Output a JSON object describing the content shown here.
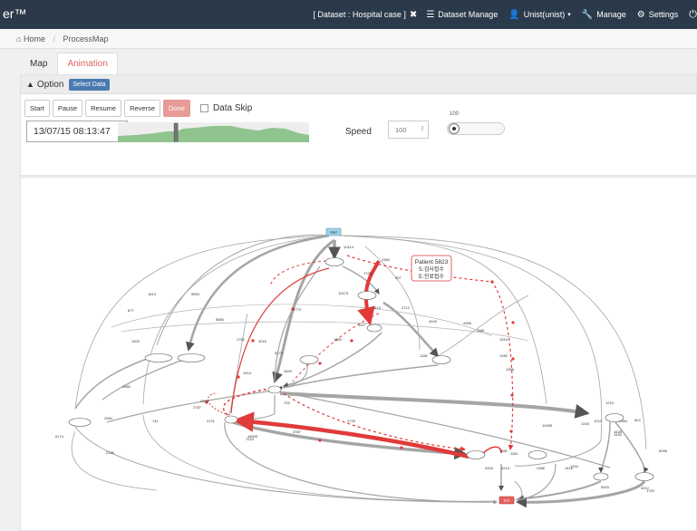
{
  "navbar": {
    "brand": "er™",
    "dataset_label": "[ Dataset : Hospital case ]",
    "dataset_manage": "Dataset Manage",
    "user": "Unist(unist)",
    "manage": "Manage",
    "settings": "Settings"
  },
  "breadcrumb": {
    "home": "Home",
    "current": "ProcessMap"
  },
  "tabs": [
    "Map",
    "Animation"
  ],
  "option": {
    "title": "Option",
    "select_data": "Select Data",
    "buttons": [
      "Start",
      "Pause",
      "Resume",
      "Reverse",
      "Done"
    ],
    "data_skip": "Data Skip",
    "time": "13/07/15 08:13:47",
    "timeline_position": 0.3,
    "speed_label": "Speed",
    "speed_value": "100",
    "slider_max": "100",
    "slider_level": 0
  },
  "process_map": {
    "start": "Start",
    "end": "End",
    "patient_label": "Patient 5823",
    "patient_line1": "S:검사접수",
    "patient_line2": "E:진료접수",
    "edge_counts": [
      "10114",
      "2350",
      "1729",
      "907",
      "10173",
      "1419",
      "3712",
      "3773",
      "1417",
      "1663",
      "4243",
      "4356",
      "1813",
      "5553",
      "877",
      "5880",
      "1000",
      "1762",
      "3016",
      "1515",
      "5173",
      "1620",
      "1514",
      "1282",
      "1582",
      "1361",
      "1198",
      "1386",
      "2363",
      "2954",
      "725",
      "2121",
      "2787",
      "741",
      "6174",
      "2136",
      "3787",
      "7215",
      "1181",
      "1581",
      "14335",
      "1215",
      "1240",
      "1334",
      "2386",
      "1210",
      "2364",
      "1430",
      "4213",
      "5003",
      "824",
      "1628",
      "1416",
      "4912",
      "1700",
      "6098",
      "4334",
      "2725",
      "16093"
    ]
  },
  "colors": {
    "navbar": "#2b3a4a",
    "accent_tab": "#e0625d",
    "animation_path": "#e03a3a",
    "edge": "#999999",
    "start_node": "#9fd2ea",
    "end_node": "#e8625c"
  }
}
